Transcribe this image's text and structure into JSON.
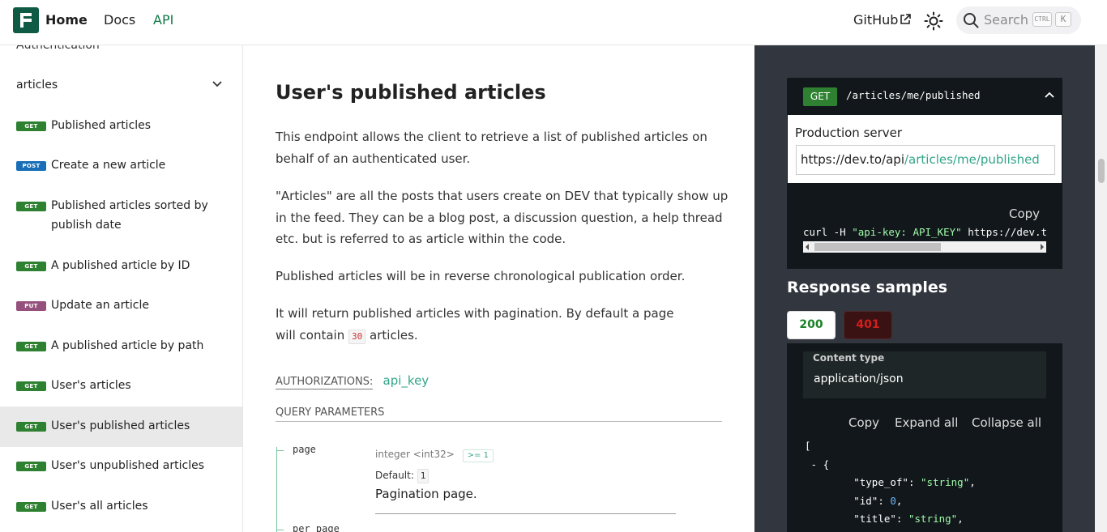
{
  "header": {
    "nav": {
      "home": "Home",
      "docs": "Docs",
      "api": "API"
    },
    "github": "GitHub",
    "search": {
      "placeholder": "Search",
      "kbd_ctrl": "CTRL",
      "kbd_k": "K"
    }
  },
  "sidebar": {
    "truncated_top": "Authentication",
    "group": "articles",
    "items": [
      {
        "method": "GET",
        "label": "Published articles"
      },
      {
        "method": "POST",
        "label": "Create a new article"
      },
      {
        "method": "GET",
        "label": "Published articles sorted by publish date"
      },
      {
        "method": "GET",
        "label": "A published article by ID"
      },
      {
        "method": "PUT",
        "label": "Update an article"
      },
      {
        "method": "GET",
        "label": "A published article by path"
      },
      {
        "method": "GET",
        "label": "User's articles"
      },
      {
        "method": "GET",
        "label": "User's published articles",
        "active": true
      },
      {
        "method": "GET",
        "label": "User's unpublished articles"
      },
      {
        "method": "GET",
        "label": "User's all articles"
      }
    ]
  },
  "main": {
    "title": "User's published articles",
    "p1": "This endpoint allows the client to retrieve a list of published articles on behalf of an authenticated user.",
    "p2": "\"Articles\" are all the posts that users create on DEV that typically show up in the feed. They can be a blog post, a discussion question, a help thread etc. but is referred to as article within the code.",
    "p3": "Published articles will be in reverse chronological publication order.",
    "p4_before": "It will return published articles with pagination. By default a page will contain",
    "p4_code": "30",
    "p4_after": "articles.",
    "auth_label": "AUTHORIZATIONS:",
    "auth_value": "api_key",
    "query_params_label": "QUERY PARAMETERS",
    "params": [
      {
        "name": "page",
        "type": "integer <int32>",
        "constraint": ">= 1",
        "default_label": "Default:",
        "default_value": "1",
        "description": "Pagination page."
      },
      {
        "name": "per_page"
      }
    ]
  },
  "right": {
    "endpoint": {
      "method": "GET",
      "path": "/articles/me/published"
    },
    "server": {
      "title": "Production server",
      "url_base": "https://dev.to/api",
      "url_path": "/articles/me/published"
    },
    "curl": {
      "copy": "Copy",
      "cmd": "curl -H ",
      "header_str": "\"api-key: API_KEY\"",
      "rest": " https://dev.to/api/articles/me/published"
    },
    "responses": {
      "title": "Response samples",
      "tabs": [
        "200",
        "401"
      ],
      "content_type_label": "Content type",
      "content_type_value": "application/json",
      "actions": {
        "copy": "Copy",
        "expand": "Expand all",
        "collapse": "Collapse all"
      }
    }
  },
  "colors": {
    "brand": "#0e5a45",
    "get": "#2f8132",
    "post": "#186fb8",
    "put": "#95507c",
    "accent": "#32a58a"
  }
}
